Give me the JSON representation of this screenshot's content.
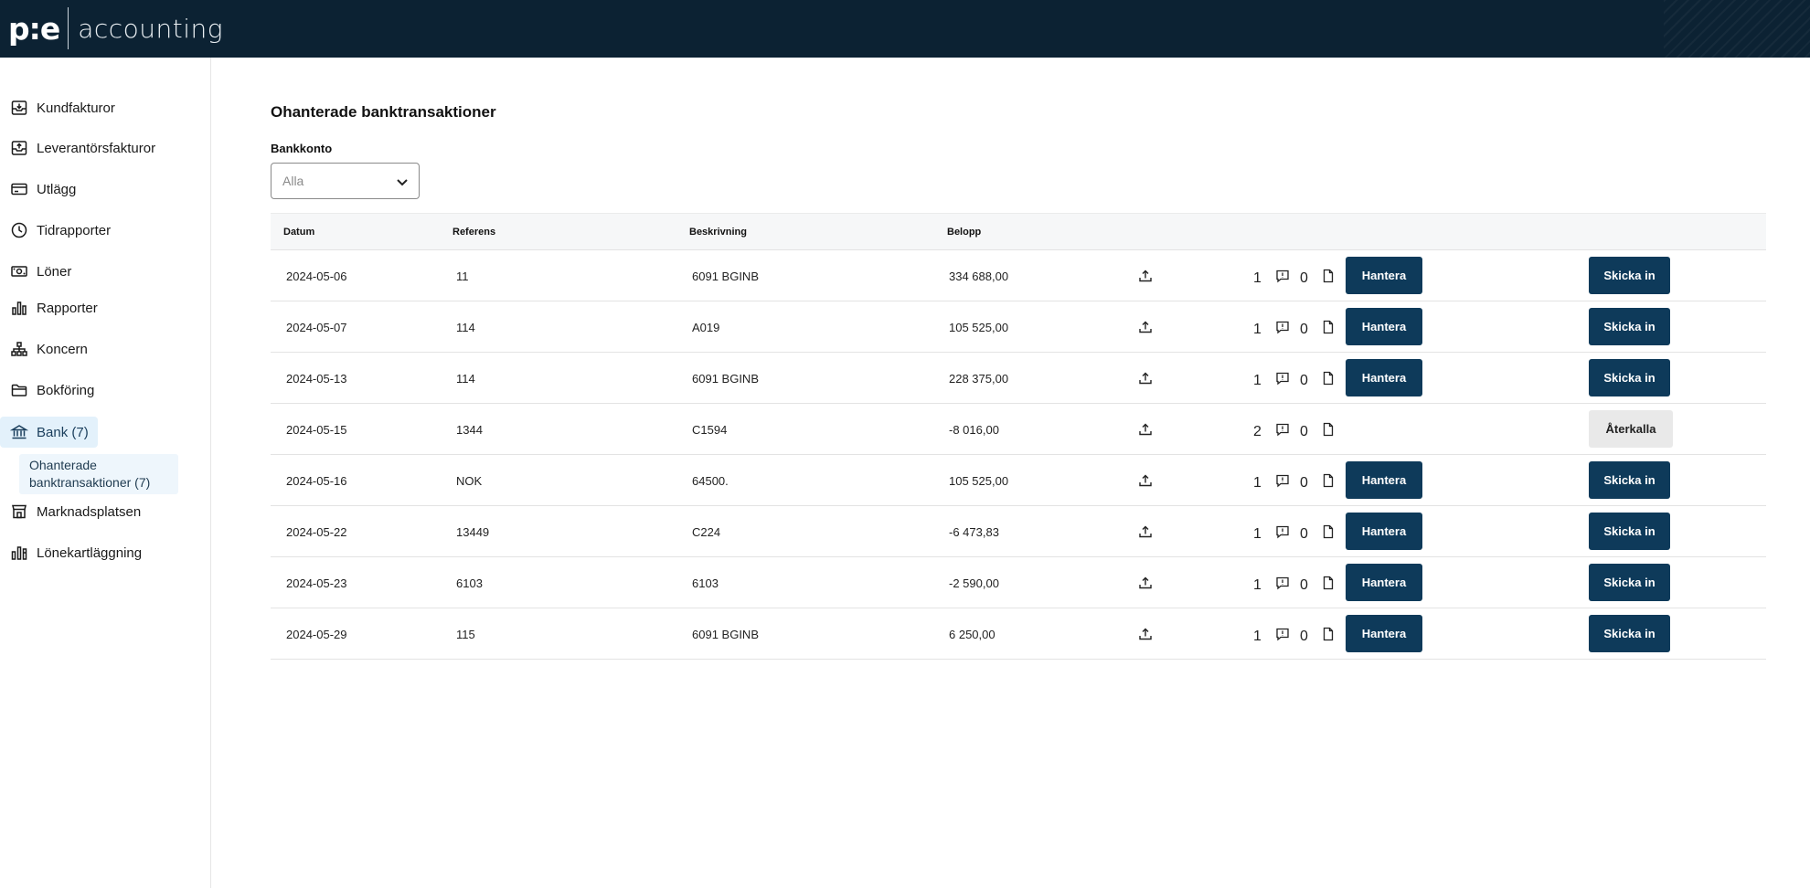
{
  "header": {
    "logo_mark": "p:e",
    "logo_text": "accounting"
  },
  "sidebar": {
    "items": [
      {
        "label": "Kundfakturor",
        "icon": "invoice-in-icon"
      },
      {
        "label": "Leverantörsfakturor",
        "icon": "invoice-out-icon"
      },
      {
        "label": "Utlägg",
        "icon": "card-icon"
      },
      {
        "label": "Tidrapporter",
        "icon": "clock-icon"
      },
      {
        "label": "Löner",
        "icon": "money-icon"
      },
      {
        "label": "Rapporter",
        "icon": "bar-chart-icon"
      },
      {
        "label": "Koncern",
        "icon": "hierarchy-icon"
      },
      {
        "label": "Bokföring",
        "icon": "folder-icon"
      },
      {
        "label": "Bank (7)",
        "icon": "bank-icon"
      },
      {
        "label": "Marknadsplatsen",
        "icon": "store-icon"
      },
      {
        "label": "Lönekartläggning",
        "icon": "chart-columns-icon"
      }
    ],
    "sub_item": "Ohanterade banktransaktioner (7)"
  },
  "main": {
    "title": "Ohanterade banktransaktioner",
    "filter": {
      "label": "Bankkonto",
      "value": "Alla"
    },
    "columns": [
      "Datum",
      "Referens",
      "Beskrivning",
      "Belopp"
    ],
    "rows": [
      {
        "datum": "2024-05-06",
        "referens": "11",
        "beskrivning": "6091 BGINB",
        "belopp": "334 688,00",
        "count": "1",
        "comments": "0",
        "hantera": "Hantera",
        "action": "Skicka in"
      },
      {
        "datum": "2024-05-07",
        "referens": "114",
        "beskrivning": "A019",
        "belopp": "105 525,00",
        "count": "1",
        "comments": "0",
        "hantera": "Hantera",
        "action": "Skicka in"
      },
      {
        "datum": "2024-05-13",
        "referens": "114",
        "beskrivning": "6091 BGINB",
        "belopp": "228 375,00",
        "count": "1",
        "comments": "0",
        "hantera": "Hantera",
        "action": "Skicka in"
      },
      {
        "datum": "2024-05-15",
        "referens": "1344",
        "beskrivning": "C1594",
        "belopp": "-8 016,00",
        "count": "2",
        "comments": "0",
        "hantera": "",
        "action": "Återkalla"
      },
      {
        "datum": "2024-05-16",
        "referens": "NOK",
        "beskrivning": "64500.",
        "belopp": " 105 525,00",
        "count": "1",
        "comments": "0",
        "hantera": "Hantera",
        "action": "Skicka in"
      },
      {
        "datum": "2024-05-22",
        "referens": "13449",
        "beskrivning": "C224",
        "belopp": "-6 473,83",
        "count": "1",
        "comments": "0",
        "hantera": "Hantera",
        "action": "Skicka in"
      },
      {
        "datum": "2024-05-23",
        "referens": "6103",
        "beskrivning": "6103",
        "belopp": "-2 590,00",
        "count": "1",
        "comments": "0",
        "hantera": "Hantera",
        "action": "Skicka in"
      },
      {
        "datum": "2024-05-29",
        "referens": "115",
        "beskrivning": "6091 BGINB",
        "belopp": "6 250,00",
        "count": "1",
        "comments": "0",
        "hantera": "Hantera",
        "action": "Skicka in"
      }
    ]
  },
  "colors": {
    "header_bg": "#0c2233",
    "primary_button": "#0e3a5a",
    "secondary_button": "#e9e9e9",
    "active_nav": "#e3f1fb"
  }
}
